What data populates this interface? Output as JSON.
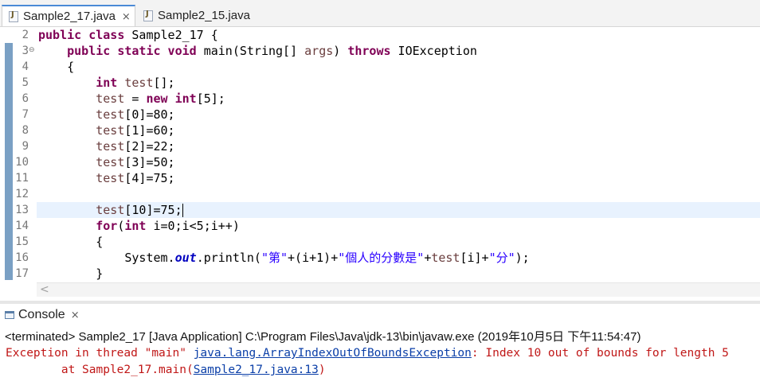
{
  "editor_tabs": [
    {
      "label": "Sample2_17.java",
      "active": true,
      "close": "⨯"
    },
    {
      "label": "Sample2_15.java",
      "active": false
    }
  ],
  "code_lines": [
    {
      "no": "2",
      "parts": [
        {
          "t": "public class",
          "c": "kw"
        },
        {
          "t": " Sample2_17 {",
          "c": ""
        }
      ]
    },
    {
      "no": "3",
      "fold": "⊖",
      "parts": [
        {
          "t": "    ",
          "c": ""
        },
        {
          "t": "public static void",
          "c": "kw"
        },
        {
          "t": " main(String[] ",
          "c": ""
        },
        {
          "t": "args",
          "c": "prm"
        },
        {
          "t": ") ",
          "c": ""
        },
        {
          "t": "throws",
          "c": "kw"
        },
        {
          "t": " IOException",
          "c": ""
        }
      ]
    },
    {
      "no": "4",
      "parts": [
        {
          "t": "    {",
          "c": ""
        }
      ]
    },
    {
      "no": "5",
      "parts": [
        {
          "t": "        ",
          "c": ""
        },
        {
          "t": "int",
          "c": "kw"
        },
        {
          "t": " ",
          "c": ""
        },
        {
          "t": "test",
          "c": "prm"
        },
        {
          "t": "[];",
          "c": ""
        }
      ]
    },
    {
      "no": "6",
      "parts": [
        {
          "t": "        ",
          "c": ""
        },
        {
          "t": "test",
          "c": "prm"
        },
        {
          "t": " = ",
          "c": ""
        },
        {
          "t": "new int",
          "c": "kw"
        },
        {
          "t": "[5];",
          "c": ""
        }
      ]
    },
    {
      "no": "7",
      "parts": [
        {
          "t": "        ",
          "c": ""
        },
        {
          "t": "test",
          "c": "prm"
        },
        {
          "t": "[0]=80;",
          "c": ""
        }
      ]
    },
    {
      "no": "8",
      "parts": [
        {
          "t": "        ",
          "c": ""
        },
        {
          "t": "test",
          "c": "prm"
        },
        {
          "t": "[1]=60;",
          "c": ""
        }
      ]
    },
    {
      "no": "9",
      "parts": [
        {
          "t": "        ",
          "c": ""
        },
        {
          "t": "test",
          "c": "prm"
        },
        {
          "t": "[2]=22;",
          "c": ""
        }
      ]
    },
    {
      "no": "10",
      "parts": [
        {
          "t": "        ",
          "c": ""
        },
        {
          "t": "test",
          "c": "prm"
        },
        {
          "t": "[3]=50;",
          "c": ""
        }
      ]
    },
    {
      "no": "11",
      "parts": [
        {
          "t": "        ",
          "c": ""
        },
        {
          "t": "test",
          "c": "prm"
        },
        {
          "t": "[4]=75;",
          "c": ""
        }
      ]
    },
    {
      "no": "12",
      "parts": []
    },
    {
      "no": "13",
      "current": true,
      "parts": [
        {
          "t": "        ",
          "c": ""
        },
        {
          "t": "test",
          "c": "prm"
        },
        {
          "t": "[10]=75;",
          "c": ""
        }
      ]
    },
    {
      "no": "14",
      "parts": [
        {
          "t": "        ",
          "c": ""
        },
        {
          "t": "for",
          "c": "kw"
        },
        {
          "t": "(",
          "c": ""
        },
        {
          "t": "int",
          "c": "kw"
        },
        {
          "t": " i=0;i<5;i++)",
          "c": ""
        }
      ]
    },
    {
      "no": "15",
      "parts": [
        {
          "t": "        {",
          "c": ""
        }
      ]
    },
    {
      "no": "16",
      "parts": [
        {
          "t": "            System.",
          "c": ""
        },
        {
          "t": "out",
          "c": "fld"
        },
        {
          "t": ".println(",
          "c": ""
        },
        {
          "t": "\"第\"",
          "c": "str"
        },
        {
          "t": "+(i+1)+",
          "c": ""
        },
        {
          "t": "\"個人的分數是\"",
          "c": "str"
        },
        {
          "t": "+",
          "c": ""
        },
        {
          "t": "test",
          "c": "prm"
        },
        {
          "t": "[i]+",
          "c": ""
        },
        {
          "t": "\"分\"",
          "c": "str"
        },
        {
          "t": ");",
          "c": ""
        }
      ]
    },
    {
      "no": "17",
      "parts": [
        {
          "t": "        }",
          "c": ""
        }
      ]
    }
  ],
  "scrollbar": {
    "left_arrow": "<"
  },
  "console": {
    "tab_label": "Console",
    "close": "⨯",
    "status": "<terminated> Sample2_17 [Java Application] C:\\Program Files\\Java\\jdk-13\\bin\\javaw.exe (2019年10月5日 下午11:54:47)",
    "line1_prefix": "Exception in thread \"main\" ",
    "line1_link": "java.lang.ArrayIndexOutOfBoundsException",
    "line1_suffix": ": Index 10 out of bounds for length 5",
    "line2_prefix": "        at Sample2_17.main(",
    "line2_link": "Sample2_17.java:13",
    "line2_suffix": ")"
  },
  "colors": {
    "keyword": "#7f0055",
    "error": "#c01717",
    "link": "#0b3fa8",
    "current_line": "#e8f2fe"
  }
}
